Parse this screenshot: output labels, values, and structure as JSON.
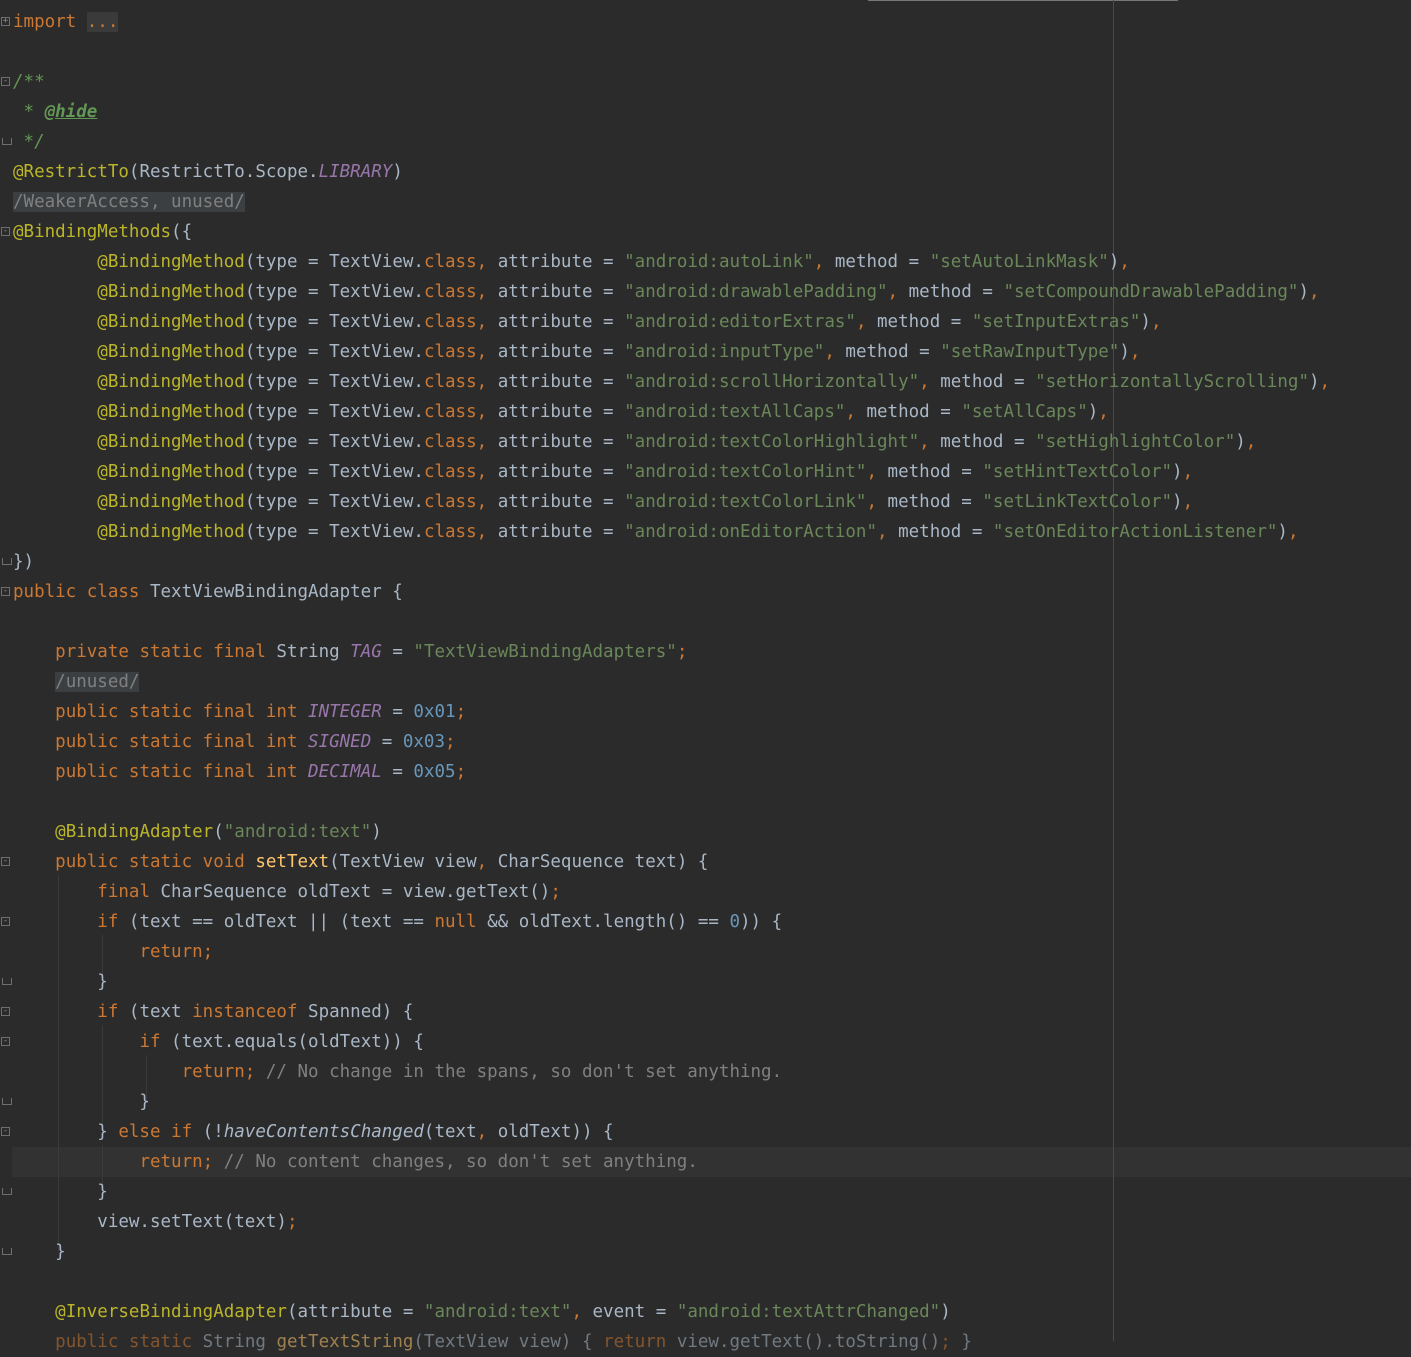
{
  "editor": {
    "language": "Java",
    "theme_colors": {
      "background": "#2b2b2b",
      "keyword": "#cc7832",
      "annotation": "#bbb529",
      "string": "#6a8759",
      "number": "#6897bb",
      "constant": "#9876aa",
      "method": "#ffc66d",
      "comment": "#808080",
      "text": "#a9b7c6"
    },
    "lines": [
      [
        [
          "kw",
          "import"
        ],
        [
          "t",
          " "
        ],
        [
          "folded",
          "..."
        ]
      ],
      [],
      [
        [
          "doc",
          "/**"
        ]
      ],
      [
        [
          "doc",
          " * "
        ],
        [
          "doctag",
          "@hide"
        ]
      ],
      [
        [
          "doc",
          " */"
        ]
      ],
      [
        [
          "ann",
          "@RestrictTo"
        ],
        [
          "t",
          "(RestrictTo.Scope."
        ],
        [
          "cst",
          "LIBRARY"
        ],
        [
          "t",
          ")"
        ]
      ],
      [
        [
          "suppress",
          "/WeakerAccess, unused/"
        ]
      ],
      [
        [
          "ann",
          "@BindingMethods"
        ],
        [
          "t",
          "({"
        ]
      ],
      [
        [
          "t",
          "        "
        ],
        [
          "ann",
          "@BindingMethod"
        ],
        [
          "t",
          "(type = TextView."
        ],
        [
          "kw",
          "class"
        ],
        [
          "kw",
          ", "
        ],
        [
          "t",
          "attribute = "
        ],
        [
          "str",
          "\"android:autoLink\""
        ],
        [
          "kw",
          ", "
        ],
        [
          "t",
          "method = "
        ],
        [
          "str",
          "\"setAutoLinkMask\""
        ],
        [
          "t",
          ")"
        ],
        [
          "kw",
          ","
        ]
      ],
      [
        [
          "t",
          "        "
        ],
        [
          "ann",
          "@BindingMethod"
        ],
        [
          "t",
          "(type = TextView."
        ],
        [
          "kw",
          "class"
        ],
        [
          "kw",
          ", "
        ],
        [
          "t",
          "attribute = "
        ],
        [
          "str",
          "\"android:drawablePadding\""
        ],
        [
          "kw",
          ", "
        ],
        [
          "t",
          "method = "
        ],
        [
          "str",
          "\"setCompoundDrawablePadding\""
        ],
        [
          "t",
          ")"
        ],
        [
          "kw",
          ","
        ]
      ],
      [
        [
          "t",
          "        "
        ],
        [
          "ann",
          "@BindingMethod"
        ],
        [
          "t",
          "(type = TextView."
        ],
        [
          "kw",
          "class"
        ],
        [
          "kw",
          ", "
        ],
        [
          "t",
          "attribute = "
        ],
        [
          "str",
          "\"android:editorExtras\""
        ],
        [
          "kw",
          ", "
        ],
        [
          "t",
          "method = "
        ],
        [
          "str",
          "\"setInputExtras\""
        ],
        [
          "t",
          ")"
        ],
        [
          "kw",
          ","
        ]
      ],
      [
        [
          "t",
          "        "
        ],
        [
          "ann",
          "@BindingMethod"
        ],
        [
          "t",
          "(type = TextView."
        ],
        [
          "kw",
          "class"
        ],
        [
          "kw",
          ", "
        ],
        [
          "t",
          "attribute = "
        ],
        [
          "str",
          "\"android:inputType\""
        ],
        [
          "kw",
          ", "
        ],
        [
          "t",
          "method = "
        ],
        [
          "str",
          "\"setRawInputType\""
        ],
        [
          "t",
          ")"
        ],
        [
          "kw",
          ","
        ]
      ],
      [
        [
          "t",
          "        "
        ],
        [
          "ann",
          "@BindingMethod"
        ],
        [
          "t",
          "(type = TextView."
        ],
        [
          "kw",
          "class"
        ],
        [
          "kw",
          ", "
        ],
        [
          "t",
          "attribute = "
        ],
        [
          "str",
          "\"android:scrollHorizontally\""
        ],
        [
          "kw",
          ", "
        ],
        [
          "t",
          "method = "
        ],
        [
          "str",
          "\"setHorizontallyScrolling\""
        ],
        [
          "t",
          ")"
        ],
        [
          "kw",
          ","
        ]
      ],
      [
        [
          "t",
          "        "
        ],
        [
          "ann",
          "@BindingMethod"
        ],
        [
          "t",
          "(type = TextView."
        ],
        [
          "kw",
          "class"
        ],
        [
          "kw",
          ", "
        ],
        [
          "t",
          "attribute = "
        ],
        [
          "str",
          "\"android:textAllCaps\""
        ],
        [
          "kw",
          ", "
        ],
        [
          "t",
          "method = "
        ],
        [
          "str",
          "\"setAllCaps\""
        ],
        [
          "t",
          ")"
        ],
        [
          "kw",
          ","
        ]
      ],
      [
        [
          "t",
          "        "
        ],
        [
          "ann",
          "@BindingMethod"
        ],
        [
          "t",
          "(type = TextView."
        ],
        [
          "kw",
          "class"
        ],
        [
          "kw",
          ", "
        ],
        [
          "t",
          "attribute = "
        ],
        [
          "str",
          "\"android:textColorHighlight\""
        ],
        [
          "kw",
          ", "
        ],
        [
          "t",
          "method = "
        ],
        [
          "str",
          "\"setHighlightColor\""
        ],
        [
          "t",
          ")"
        ],
        [
          "kw",
          ","
        ]
      ],
      [
        [
          "t",
          "        "
        ],
        [
          "ann",
          "@BindingMethod"
        ],
        [
          "t",
          "(type = TextView."
        ],
        [
          "kw",
          "class"
        ],
        [
          "kw",
          ", "
        ],
        [
          "t",
          "attribute = "
        ],
        [
          "str",
          "\"android:textColorHint\""
        ],
        [
          "kw",
          ", "
        ],
        [
          "t",
          "method = "
        ],
        [
          "str",
          "\"setHintTextColor\""
        ],
        [
          "t",
          ")"
        ],
        [
          "kw",
          ","
        ]
      ],
      [
        [
          "t",
          "        "
        ],
        [
          "ann",
          "@BindingMethod"
        ],
        [
          "t",
          "(type = TextView."
        ],
        [
          "kw",
          "class"
        ],
        [
          "kw",
          ", "
        ],
        [
          "t",
          "attribute = "
        ],
        [
          "str",
          "\"android:textColorLink\""
        ],
        [
          "kw",
          ", "
        ],
        [
          "t",
          "method = "
        ],
        [
          "str",
          "\"setLinkTextColor\""
        ],
        [
          "t",
          ")"
        ],
        [
          "kw",
          ","
        ]
      ],
      [
        [
          "t",
          "        "
        ],
        [
          "ann",
          "@BindingMethod"
        ],
        [
          "t",
          "(type = TextView."
        ],
        [
          "kw",
          "class"
        ],
        [
          "kw",
          ", "
        ],
        [
          "t",
          "attribute = "
        ],
        [
          "str",
          "\"android:onEditorAction\""
        ],
        [
          "kw",
          ", "
        ],
        [
          "t",
          "method = "
        ],
        [
          "str",
          "\"setOnEditorActionListener\""
        ],
        [
          "t",
          ")"
        ],
        [
          "kw",
          ","
        ]
      ],
      [
        [
          "t",
          "})"
        ]
      ],
      [
        [
          "kw",
          "public class "
        ],
        [
          "t",
          "TextViewBindingAdapter {"
        ]
      ],
      [],
      [
        [
          "t",
          "    "
        ],
        [
          "kw",
          "private static final "
        ],
        [
          "t",
          "String "
        ],
        [
          "cst",
          "TAG"
        ],
        [
          "t",
          " = "
        ],
        [
          "str",
          "\"TextViewBindingAdapters\""
        ],
        [
          "kw",
          ";"
        ]
      ],
      [
        [
          "t",
          "    "
        ],
        [
          "suppress",
          "/unused/"
        ]
      ],
      [
        [
          "t",
          "    "
        ],
        [
          "kw",
          "public static final int "
        ],
        [
          "cst",
          "INTEGER"
        ],
        [
          "t",
          " = "
        ],
        [
          "num",
          "0x01"
        ],
        [
          "kw",
          ";"
        ]
      ],
      [
        [
          "t",
          "    "
        ],
        [
          "kw",
          "public static final int "
        ],
        [
          "cst",
          "SIGNED"
        ],
        [
          "t",
          " = "
        ],
        [
          "num",
          "0x03"
        ],
        [
          "kw",
          ";"
        ]
      ],
      [
        [
          "t",
          "    "
        ],
        [
          "kw",
          "public static final int "
        ],
        [
          "cst",
          "DECIMAL"
        ],
        [
          "t",
          " = "
        ],
        [
          "num",
          "0x05"
        ],
        [
          "kw",
          ";"
        ]
      ],
      [],
      [
        [
          "t",
          "    "
        ],
        [
          "ann",
          "@BindingAdapter"
        ],
        [
          "t",
          "("
        ],
        [
          "str",
          "\"android:text\""
        ],
        [
          "t",
          ")"
        ]
      ],
      [
        [
          "t",
          "    "
        ],
        [
          "kw",
          "public static void "
        ],
        [
          "fn",
          "setText"
        ],
        [
          "t",
          "(TextView view"
        ],
        [
          "kw",
          ", "
        ],
        [
          "t",
          "CharSequence text) {"
        ]
      ],
      [
        [
          "t",
          "        "
        ],
        [
          "kw",
          "final "
        ],
        [
          "t",
          "CharSequence oldText = view.getText()"
        ],
        [
          "kw",
          ";"
        ]
      ],
      [
        [
          "t",
          "        "
        ],
        [
          "kw",
          "if "
        ],
        [
          "t",
          "(text == oldText || (text == "
        ],
        [
          "kw",
          "null "
        ],
        [
          "t",
          "&& oldText.length() == "
        ],
        [
          "num",
          "0"
        ],
        [
          "t",
          ")) {"
        ]
      ],
      [
        [
          "t",
          "            "
        ],
        [
          "kw",
          "return;"
        ]
      ],
      [
        [
          "t",
          "        }"
        ]
      ],
      [
        [
          "t",
          "        "
        ],
        [
          "kw",
          "if "
        ],
        [
          "t",
          "(text "
        ],
        [
          "kw",
          "instanceof "
        ],
        [
          "t",
          "Spanned) {"
        ]
      ],
      [
        [
          "t",
          "            "
        ],
        [
          "kw",
          "if "
        ],
        [
          "t",
          "(text.equals(oldText)) {"
        ]
      ],
      [
        [
          "t",
          "                "
        ],
        [
          "kw",
          "return; "
        ],
        [
          "cmt",
          "// No change in the spans, so don't set anything."
        ]
      ],
      [
        [
          "t",
          "            }"
        ]
      ],
      [
        [
          "t",
          "        } "
        ],
        [
          "kw",
          "else if "
        ],
        [
          "t",
          "(!"
        ],
        [
          "ital",
          "haveContentsChanged"
        ],
        [
          "t",
          "(text"
        ],
        [
          "kw",
          ", "
        ],
        [
          "t",
          "oldText)) {"
        ]
      ],
      [
        [
          "t",
          "            "
        ],
        [
          "kw",
          "return; "
        ],
        [
          "cmt",
          "// No content changes, so don't set anything."
        ]
      ],
      [
        [
          "t",
          "        }"
        ]
      ],
      [
        [
          "t",
          "        view.setText(text)"
        ],
        [
          "kw",
          ";"
        ]
      ],
      [
        [
          "t",
          "    }"
        ]
      ],
      [],
      [
        [
          "t",
          "    "
        ],
        [
          "ann",
          "@InverseBindingAdapter"
        ],
        [
          "t",
          "(attribute = "
        ],
        [
          "str",
          "\"android:text\""
        ],
        [
          "kw",
          ", "
        ],
        [
          "t",
          "event = "
        ],
        [
          "str",
          "\"android:textAttrChanged\""
        ],
        [
          "t",
          ")"
        ]
      ],
      [
        [
          "t",
          "    "
        ],
        [
          "kw",
          "public static "
        ],
        [
          "t",
          "String "
        ],
        [
          "fn",
          "getTextString"
        ],
        [
          "t",
          "(TextView view) { "
        ],
        [
          "kw",
          "return "
        ],
        [
          "t",
          "view.getText().toString()"
        ],
        [
          "kw",
          "; "
        ],
        [
          "t",
          "}"
        ]
      ]
    ]
  }
}
